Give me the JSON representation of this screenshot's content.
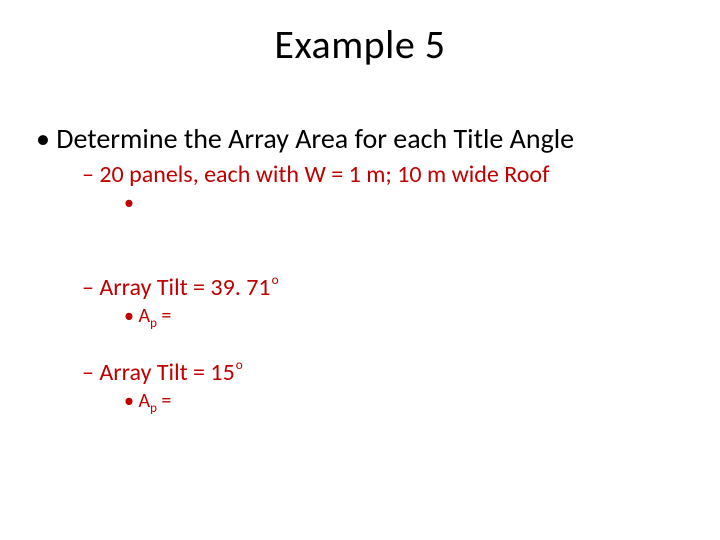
{
  "title": "Example 5",
  "l1_text": "Determine the Array Area for each Title Angle",
  "l2_a": "20 panels, each with W = 1 m; 10 m wide Roof",
  "l2_b_prefix": "Array Tilt = 39. 71",
  "l2_c_prefix": "Array Tilt = 15",
  "deg": "o",
  "ap_A": "A",
  "ap_p": "p",
  "ap_eq": " = "
}
